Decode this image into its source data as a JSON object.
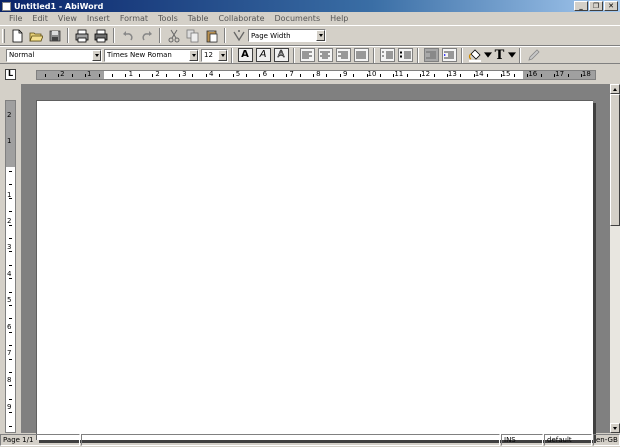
{
  "window": {
    "title": "Untitled1 - AbiWord"
  },
  "menu": [
    "File",
    "Edit",
    "View",
    "Insert",
    "Format",
    "Tools",
    "Table",
    "Collaborate",
    "Documents",
    "Help"
  ],
  "toolbar": {
    "zoom_value": "Page Width",
    "style_value": "Normal",
    "font_value": "Times New Roman",
    "size_value": "12",
    "bold_label": "A",
    "italic_label": "A",
    "outline_label": "A",
    "font_color_label": "T"
  },
  "ruler": {
    "horizontal_labels": [
      "2",
      "1",
      "1",
      "2",
      "3",
      "4",
      "5",
      "6",
      "7",
      "8",
      "9",
      "10",
      "11",
      "12",
      "13",
      "14",
      "15",
      "16",
      "17",
      "18"
    ],
    "vertical_labels": [
      "2",
      "1",
      "1",
      "2",
      "3",
      "4",
      "5",
      "6",
      "7",
      "8",
      "9"
    ],
    "tab_selector": "L"
  },
  "status": {
    "page": "Page 1/1",
    "mode": "INS",
    "style": "default",
    "lang": "en-GB"
  }
}
